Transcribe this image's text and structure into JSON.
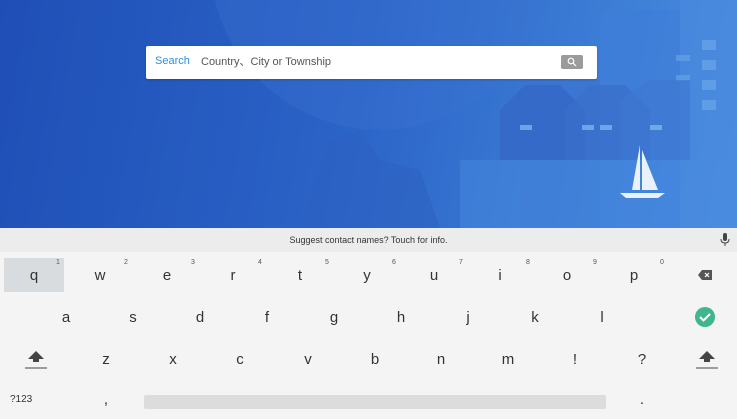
{
  "search": {
    "label": "Search",
    "placeholder": "Country、City or Township",
    "button_icon": "search-icon"
  },
  "keyboard": {
    "suggestion": "Suggest contact names? Touch for info.",
    "row1": [
      {
        "key": "q",
        "hint": "1"
      },
      {
        "key": "w",
        "hint": "2"
      },
      {
        "key": "e",
        "hint": "3"
      },
      {
        "key": "r",
        "hint": "4"
      },
      {
        "key": "t",
        "hint": "5"
      },
      {
        "key": "y",
        "hint": "6"
      },
      {
        "key": "u",
        "hint": "7"
      },
      {
        "key": "i",
        "hint": "8"
      },
      {
        "key": "o",
        "hint": "9"
      },
      {
        "key": "p",
        "hint": "0"
      }
    ],
    "row2": [
      "a",
      "s",
      "d",
      "f",
      "g",
      "h",
      "j",
      "k",
      "l"
    ],
    "row3": [
      "z",
      "x",
      "c",
      "v",
      "b",
      "n",
      "m",
      "!",
      "?"
    ],
    "symbols_label": "?123",
    "comma": ",",
    "period": "."
  },
  "colors": {
    "accent": "#2e8fe0",
    "enter": "#3fb68b",
    "hero_start": "#1f4fb6",
    "hero_end": "#4b8fe0"
  }
}
